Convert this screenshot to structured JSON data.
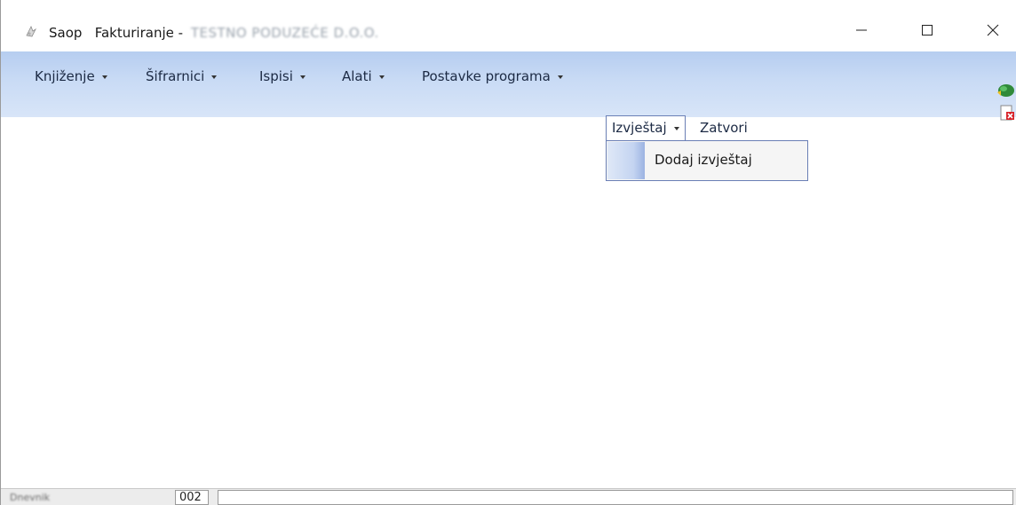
{
  "window": {
    "app_name": "Saop",
    "title": "Fakturiranje -",
    "company_blurred": "TESTNO PODUZEĆE D.O.O.",
    "controls": {
      "minimize_icon": "minimize-icon",
      "maximize_icon": "maximize-icon",
      "close_icon": "close-icon"
    }
  },
  "menubar": {
    "items": [
      {
        "label": "Knjiženje",
        "has_arrow": true
      },
      {
        "label": "Šifrarnici",
        "has_arrow": true
      },
      {
        "label": "Ispisi",
        "has_arrow": true
      },
      {
        "label": "Alati",
        "has_arrow": true
      },
      {
        "label": "Postavke programa",
        "has_arrow": true
      },
      {
        "label": "Izvještaj",
        "has_arrow": true,
        "open": true
      },
      {
        "label": "Zatvori",
        "has_arrow": false
      }
    ],
    "side_icons": [
      "help-icon",
      "exit-icon"
    ],
    "gradient_colors": [
      "#b6cdf0",
      "#d8e5f8"
    ]
  },
  "dropdown": {
    "parent": "Izvještaj",
    "items": [
      {
        "label": "Dodaj izvještaj"
      }
    ]
  },
  "statusbar": {
    "blurred_text": "Dnevnik",
    "code": "002",
    "main": ""
  }
}
